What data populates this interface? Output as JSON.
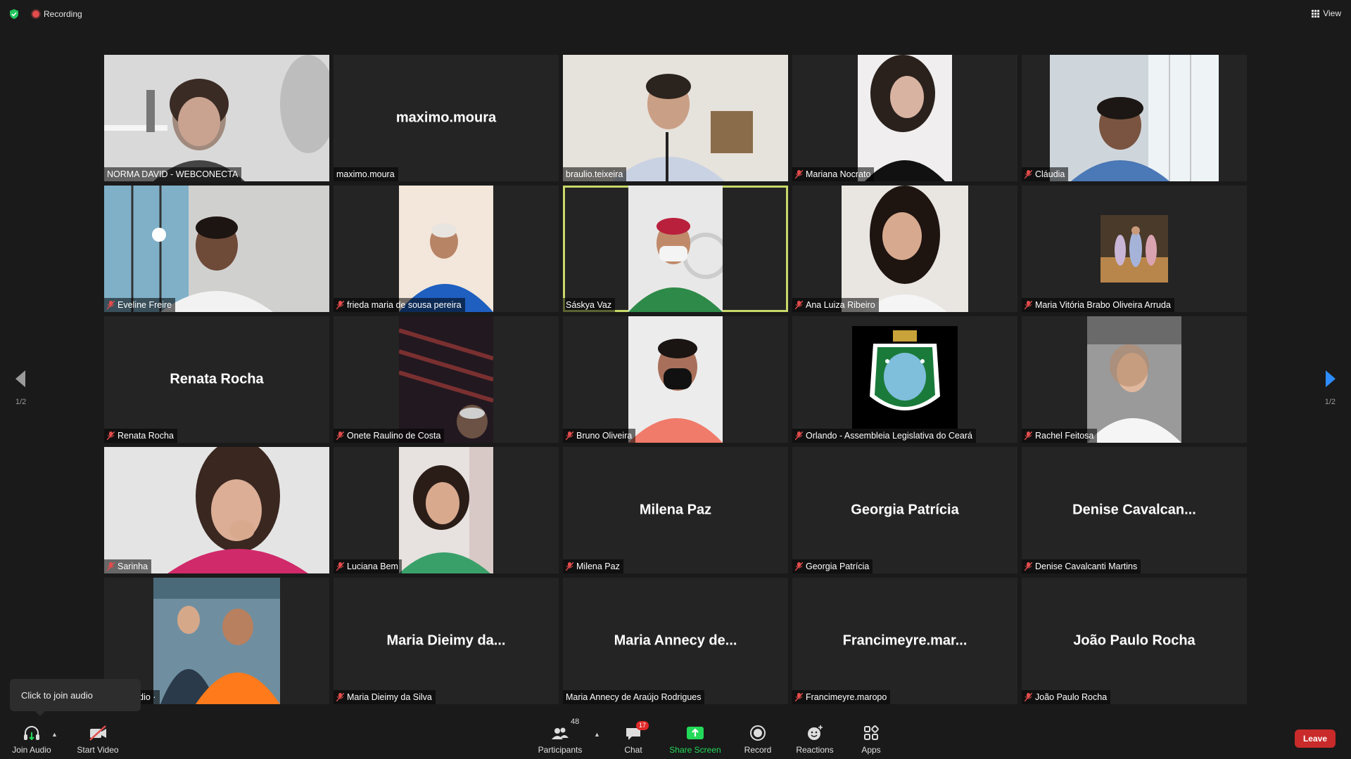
{
  "topbar": {
    "recording_label": "Recording",
    "view_label": "View"
  },
  "pagination": {
    "left_page": "1/2",
    "right_page": "1/2"
  },
  "participants": [
    {
      "label": "NORMA DAVID - WEBCONECTA",
      "big_name": "",
      "muted": false,
      "video": "woman with headset, light room"
    },
    {
      "label": "maximo.moura",
      "big_name": "maximo.moura",
      "muted": false,
      "video": ""
    },
    {
      "label": "braulio.teixeira",
      "big_name": "",
      "muted": false,
      "video": "man with glasses, office"
    },
    {
      "label": "Mariana Nocrato",
      "big_name": "",
      "muted": true,
      "video": "woman with curly hair"
    },
    {
      "label": "Cláudia",
      "big_name": "",
      "muted": true,
      "video": "woman with glasses, window"
    },
    {
      "label": "Eveline Freire",
      "big_name": "",
      "muted": true,
      "video": "woman near window"
    },
    {
      "label": "frieda maria de sousa pereira",
      "big_name": "",
      "muted": true,
      "video": "woman in blue dress"
    },
    {
      "label": "Sáskya Vaz",
      "big_name": "",
      "muted": false,
      "video": "woman with mask"
    },
    {
      "label": "Ana Luiza Ribeiro",
      "big_name": "",
      "muted": true,
      "video": "smiling woman"
    },
    {
      "label": "Maria Vitória Brabo Oliveira Arruda",
      "big_name": "",
      "muted": true,
      "video": "group photo"
    },
    {
      "label": "Renata Rocha",
      "big_name": "Renata Rocha",
      "muted": true,
      "video": ""
    },
    {
      "label": "Onete Raulino de Costa",
      "big_name": "",
      "muted": true,
      "video": "dark ceiling"
    },
    {
      "label": "Bruno Oliveira",
      "big_name": "",
      "muted": true,
      "video": "man with mask"
    },
    {
      "label": "Orlando - Assembleia Legislativa do Ceará",
      "big_name": "",
      "muted": true,
      "video": "coat of arms"
    },
    {
      "label": "Rachel Feitosa",
      "big_name": "",
      "muted": true,
      "video": "woman in office"
    },
    {
      "label": "Sarinha",
      "big_name": "",
      "muted": true,
      "video": "woman with hand on chin"
    },
    {
      "label": "Luciana Bem",
      "big_name": "",
      "muted": true,
      "video": "woman in green top"
    },
    {
      "label": "Milena Paz",
      "big_name": "Milena Paz",
      "muted": true,
      "video": ""
    },
    {
      "label": "Georgia Patrícia",
      "big_name": "Georgia Patrícia",
      "muted": true,
      "video": ""
    },
    {
      "label": "Denise Cavalcanti Martins",
      "big_name": "Denise  Cavalcan...",
      "muted": true,
      "video": ""
    },
    {
      "label": "ng to audio ·",
      "big_name": "",
      "muted": false,
      "video": "two men giving thumbs up"
    },
    {
      "label": "Maria Dieimy da Silva",
      "big_name": "Maria Dieimy da...",
      "muted": true,
      "video": ""
    },
    {
      "label": "Maria Annecy de Araújo Rodrigues",
      "big_name": "Maria Annecy de...",
      "muted": false,
      "video": ""
    },
    {
      "label": "Francimeyre.maropo",
      "big_name": "Francimeyre.mar...",
      "muted": true,
      "video": ""
    },
    {
      "label": "João Paulo Rocha",
      "big_name": "João Paulo Rocha",
      "muted": true,
      "video": ""
    }
  ],
  "tooltip": {
    "text": "Click to join audio"
  },
  "toolbar": {
    "join_audio": "Join Audio",
    "start_video": "Start Video",
    "participants": "Participants",
    "participants_count": "48",
    "chat": "Chat",
    "chat_badge": "17",
    "share_screen": "Share Screen",
    "record": "Record",
    "reactions": "Reactions",
    "apps": "Apps",
    "leave": "Leave"
  },
  "colors": {
    "background": "#1a1a1a",
    "tile": "#242424",
    "active_speaker": "#c9d86a",
    "share_green": "#23d959",
    "leave_red": "#c92a2a",
    "mute_red": "#e34c4c",
    "nav_blue": "#2d8cff"
  }
}
